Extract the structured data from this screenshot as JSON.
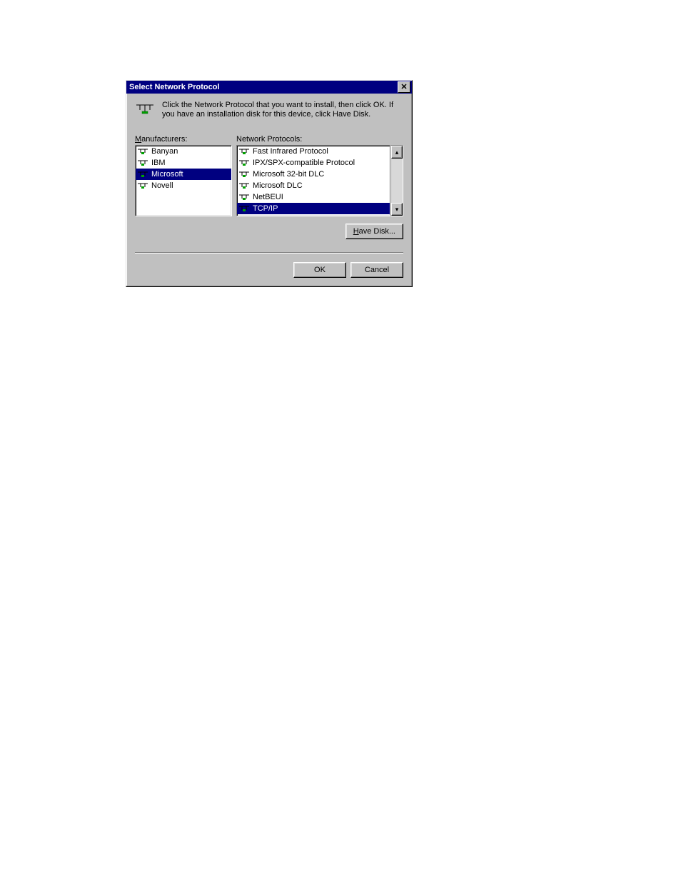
{
  "dialog": {
    "title": "Select Network Protocol",
    "instruction": "Click the Network Protocol that you want to install, then click OK. If you have an installation disk for this device, click Have Disk."
  },
  "labels": {
    "manufacturers_prefix": "M",
    "manufacturers_rest": "anufacturers:",
    "protocols": "Network Protocols:"
  },
  "manufacturers": {
    "items": [
      "Banyan",
      "IBM",
      "Microsoft",
      "Novell"
    ],
    "selected_index": 2
  },
  "protocols": {
    "items": [
      "Fast Infrared Protocol",
      "IPX/SPX-compatible Protocol",
      "Microsoft 32-bit DLC",
      "Microsoft DLC",
      "NetBEUI",
      "TCP/IP"
    ],
    "selected_index": 5
  },
  "buttons": {
    "have_disk_prefix": "H",
    "have_disk_rest": "ave Disk...",
    "ok": "OK",
    "cancel": "Cancel"
  }
}
